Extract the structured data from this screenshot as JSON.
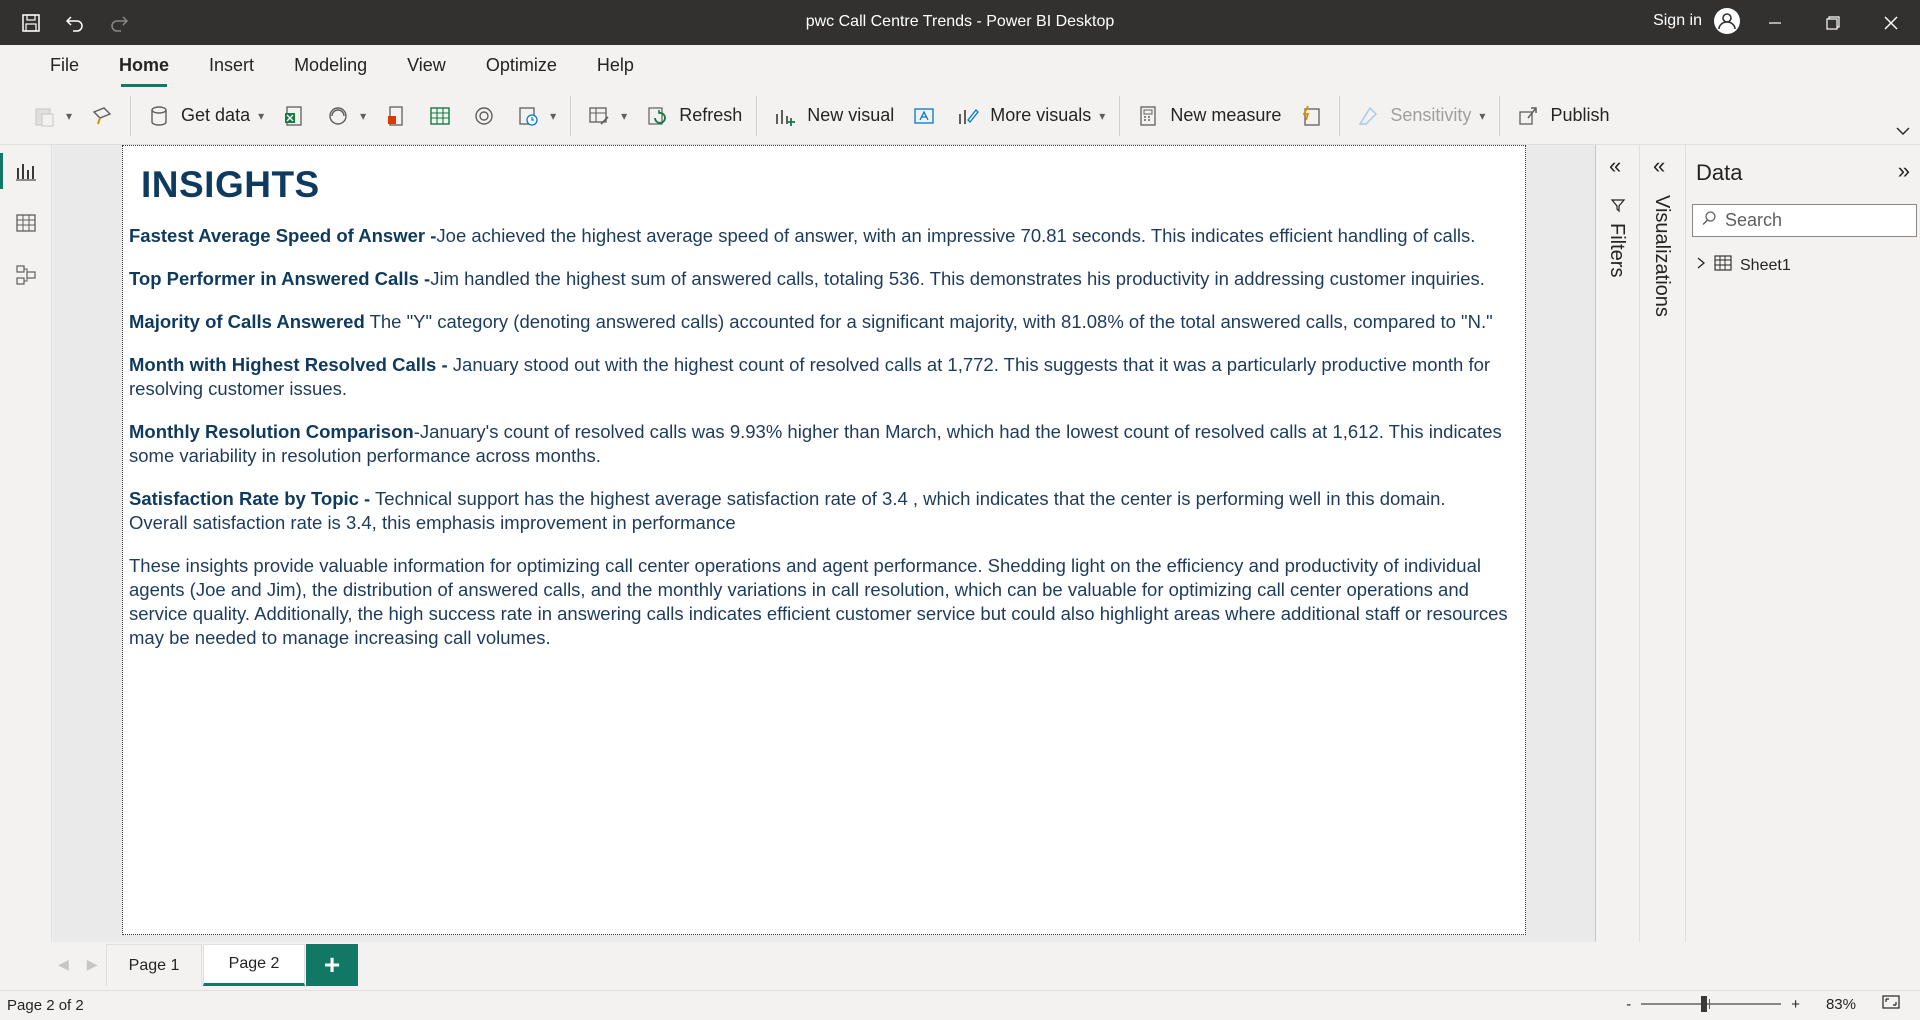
{
  "window": {
    "title": "pwc Call Centre Trends - Power BI Desktop",
    "sign_in": "Sign in"
  },
  "menu": {
    "tabs": [
      "File",
      "Home",
      "Insert",
      "Modeling",
      "View",
      "Optimize",
      "Help"
    ],
    "active": "Home"
  },
  "ribbon": {
    "get_data": "Get data",
    "refresh": "Refresh",
    "new_visual": "New visual",
    "more_visuals": "More visuals",
    "new_measure": "New measure",
    "sensitivity": "Sensitivity",
    "publish": "Publish"
  },
  "report": {
    "title": "INSIGHTS",
    "insights": [
      {
        "heading": "Fastest Average Speed of Answer -",
        "body": "Joe achieved the highest average speed of answer, with an impressive 70.81 seconds. This indicates efficient handling of calls."
      },
      {
        "heading": "Top Performer in Answered Calls -",
        "body": "Jim handled the highest sum of answered calls, totaling 536. This demonstrates his productivity in addressing customer inquiries."
      },
      {
        "heading": "Majority of Calls Answered",
        "body": " The \"Y\" category (denoting answered calls) accounted for a significant majority, with 81.08% of the total answered calls, compared to \"N.\""
      },
      {
        "heading": "Month with Highest Resolved Calls -",
        "body": " January stood out with the highest count of resolved calls at 1,772. This suggests that it was a particularly productive month for resolving customer issues."
      },
      {
        "heading": "Monthly Resolution Comparison",
        "body": "-January's count of resolved calls was 9.93% higher than March, which had the lowest count of resolved calls at 1,612. This indicates some variability in resolution performance across months."
      },
      {
        "heading": "Satisfaction Rate by Topic -",
        "body": " Technical support has the highest average satisfaction rate of 3.4 , which indicates that the center is performing well in this domain. Overall satisfaction rate is 3.4, this emphasis improvement in performance"
      }
    ],
    "summary": "These insights provide valuable information for optimizing call center operations and agent performance. Shedding light on the efficiency and productivity of individual agents (Joe and Jim), the distribution of answered calls, and the monthly variations in call resolution, which can be valuable for optimizing call center operations and service quality. Additionally, the high success rate in answering calls indicates efficient customer service but could also highlight areas where additional staff or resources may be needed to manage increasing call volumes."
  },
  "panes": {
    "filters_label": "Filters",
    "visualizations_label": "Visualizations",
    "data_title": "Data",
    "search_placeholder": "Search",
    "tables": [
      "Sheet1"
    ]
  },
  "pages": {
    "tabs": [
      "Page 1",
      "Page 2"
    ],
    "active": "Page 2",
    "add_label": "+"
  },
  "status": {
    "page_indicator": "Page 2 of 2",
    "zoom": "83%",
    "zoom_minus": "-",
    "zoom_plus": "+"
  },
  "colors": {
    "accent": "#117865",
    "title_bar": "#323130",
    "insight_text": "#1d3b5c"
  }
}
